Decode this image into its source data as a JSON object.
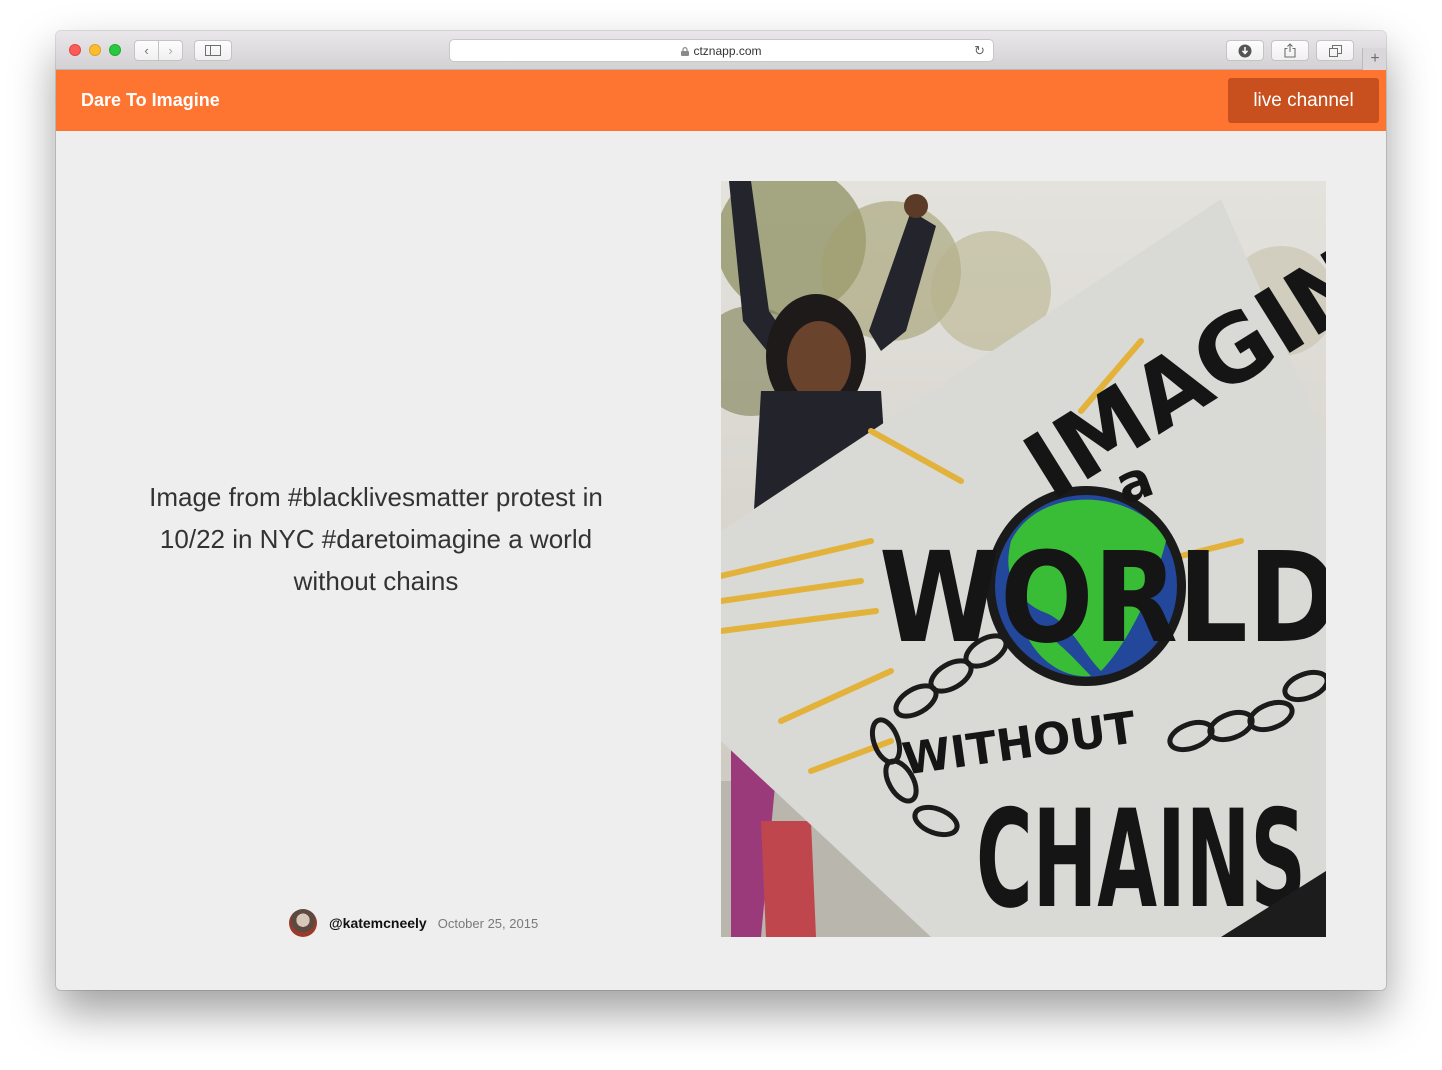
{
  "browser": {
    "url": "ctznapp.com",
    "new_tab_label": "+"
  },
  "header": {
    "brand": "Dare To Imagine",
    "live_button": "live channel",
    "background": "#fe7431",
    "button_color": "#c8501f"
  },
  "post": {
    "caption": "Image from #blacklivesmatter protest in 10/22 in NYC #daretoimagine a world without chains",
    "username": "@katemcneely",
    "date": "October 25, 2015"
  },
  "photo": {
    "sign_lines": [
      "IMAGINE",
      "a",
      "WORLD",
      "WITHOUT",
      "CHAINS"
    ]
  }
}
